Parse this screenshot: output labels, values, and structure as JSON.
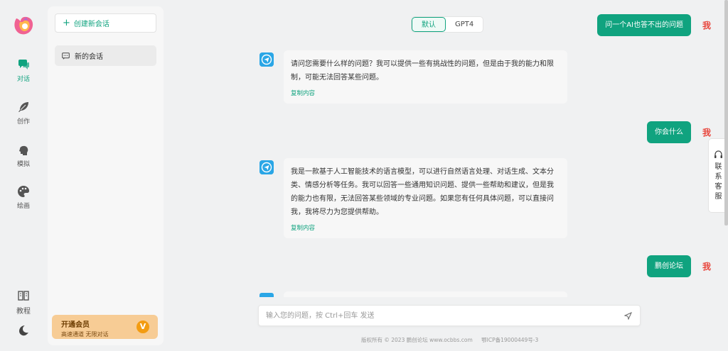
{
  "rail": {
    "items": [
      {
        "label": "对话",
        "icon": "chat-icon",
        "active": true
      },
      {
        "label": "创作",
        "icon": "feather-icon",
        "active": false
      },
      {
        "label": "模拟",
        "icon": "head-icon",
        "active": false
      },
      {
        "label": "绘画",
        "icon": "palette-icon",
        "active": false
      }
    ],
    "tutorial": "教程",
    "theme_icon": "moon-icon"
  },
  "sessions": {
    "new_label": "创建新会话",
    "items": [
      {
        "label": "新的会话"
      }
    ],
    "vip": {
      "title": "开通会员",
      "subtitle": "高速通道 无限对话",
      "badge": "V"
    }
  },
  "model_switch": {
    "options": [
      "默认",
      "GPT4"
    ],
    "selected": "默认"
  },
  "messages": {
    "user_tag": "我",
    "user_1": "问一个AI也答不出的问题",
    "bot_1": "请问您需要什么样的问题？我可以提供一些有挑战性的问题，但是由于我的能力和限制，可能无法回答某些问题。",
    "user_2": "你会什么",
    "bot_2": "我是一款基于人工智能技术的语言模型，可以进行自然语言处理、对话生成、文本分类、情感分析等任务。我可以回答一些通用知识问题、提供一些帮助和建议，但是我的能力也有限，无法回答某些领域的专业问题。如果您有任何具体问题，可以直接问我，我将尽力为您提供帮助。",
    "user_3": "鹏创论坛",
    "copy_label": "复制内容"
  },
  "input": {
    "placeholder": "输入您的问题，按 Ctrl+回车 发送",
    "value": ""
  },
  "footer": {
    "copyright": "版权所有 © 2023 鹏创论坛 www.ocbbs.com",
    "icp": "鄂ICP备19000449号-3"
  },
  "service": {
    "label": "联系客服"
  },
  "colors": {
    "accent": "#10a37f",
    "user_tag": "#e8453c",
    "vip_bg": "#f7cc95",
    "bot_avatar": "#2aa6e6"
  }
}
